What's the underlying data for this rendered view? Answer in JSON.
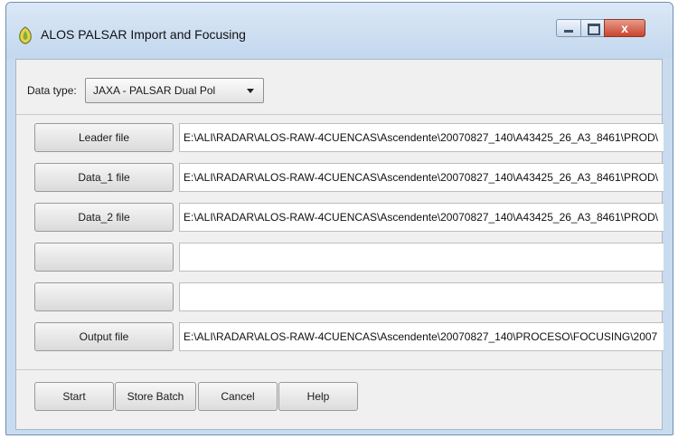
{
  "window": {
    "title": "ALOS PALSAR Import and Focusing",
    "close_glyph": "x"
  },
  "datatype": {
    "label": "Data type:",
    "selected": "JAXA - PALSAR Dual Pol"
  },
  "files": [
    {
      "button": "Leader file",
      "path": "E:\\ALI\\RADAR\\ALOS-RAW-4CUENCAS\\Ascendente\\20070827_140\\A43425_26_A3_8461\\PROD\\"
    },
    {
      "button": "Data_1 file",
      "path": "E:\\ALI\\RADAR\\ALOS-RAW-4CUENCAS\\Ascendente\\20070827_140\\A43425_26_A3_8461\\PROD\\"
    },
    {
      "button": "Data_2 file",
      "path": "E:\\ALI\\RADAR\\ALOS-RAW-4CUENCAS\\Ascendente\\20070827_140\\A43425_26_A3_8461\\PROD\\"
    },
    {
      "button": "",
      "path": ""
    },
    {
      "button": "",
      "path": ""
    },
    {
      "button": "Output file",
      "path": "E:\\ALI\\RADAR\\ALOS-RAW-4CUENCAS\\Ascendente\\20070827_140\\PROCESO\\FOCUSING\\2007"
    }
  ],
  "actions": {
    "start": "Start",
    "store_batch": "Store Batch",
    "cancel": "Cancel",
    "help": "Help"
  },
  "colors": {
    "title_bar": "#c3d7ee",
    "close_button": "#c7452e",
    "client_bg": "#f0f0f0"
  },
  "icons": [
    "app-icon",
    "minimize-icon",
    "maximize-icon",
    "close-icon",
    "dropdown-arrow-icon"
  ]
}
